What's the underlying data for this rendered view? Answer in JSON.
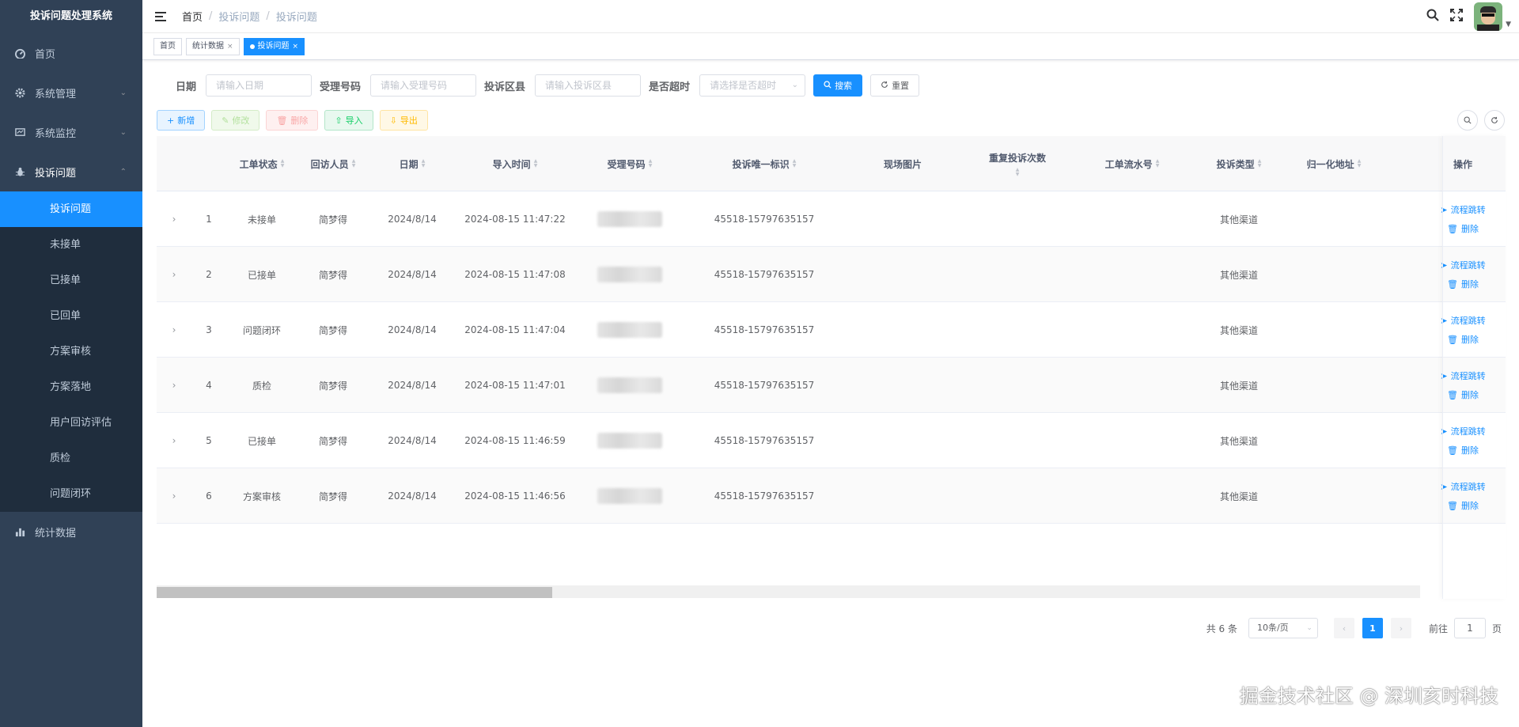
{
  "app_title": "投诉问题处理系统",
  "sidebar": {
    "items": [
      {
        "label": "首页",
        "icon": "dashboard-icon"
      },
      {
        "label": "系统管理",
        "icon": "gear-icon",
        "expandable": true
      },
      {
        "label": "系统监控",
        "icon": "monitor-icon",
        "expandable": true
      },
      {
        "label": "投诉问题",
        "icon": "bug-icon",
        "expanded": true
      },
      {
        "label": "统计数据",
        "icon": "bar-chart-icon"
      }
    ],
    "sub_items": [
      "投诉问题",
      "未接单",
      "已接单",
      "已回单",
      "方案审核",
      "方案落地",
      "用户回访评估",
      "质检",
      "问题闭环"
    ],
    "active_sub": "投诉问题"
  },
  "header": {
    "breadcrumb": [
      "首页",
      "投诉问题",
      "投诉问题"
    ]
  },
  "tags": [
    {
      "label": "首页"
    },
    {
      "label": "统计数据"
    },
    {
      "label": "投诉问题",
      "active": true
    }
  ],
  "filter": {
    "date_label": "日期",
    "date_placeholder": "请输入日期",
    "accept_label": "受理号码",
    "accept_placeholder": "请输入受理号码",
    "district_label": "投诉区县",
    "district_placeholder": "请输入投诉区县",
    "timeout_label": "是否超时",
    "timeout_placeholder": "请选择是否超时",
    "search_label": "搜索",
    "reset_label": "重置"
  },
  "toolbar": {
    "add": "新增",
    "edit": "修改",
    "delete": "删除",
    "import": "导入",
    "export": "导出"
  },
  "table": {
    "headers": {
      "status": "工单状态",
      "visitor": "回访人员",
      "date": "日期",
      "import_time": "导入时间",
      "accept_no": "受理号码",
      "unique_id": "投诉唯一标识",
      "photo": "现场图片",
      "repeat": "重复投诉次数",
      "flow_no": "工单流水号",
      "type": "投诉类型",
      "addr": "归一化地址",
      "ops": "操作"
    },
    "rows": [
      {
        "idx": "1",
        "status": "未接单",
        "visitor": "简梦得",
        "date": "2024/8/14",
        "import_time": "2024-08-15 11:47:22",
        "unique_id": "45518-15797635157",
        "type": "其他渠道"
      },
      {
        "idx": "2",
        "status": "已接单",
        "visitor": "简梦得",
        "date": "2024/8/14",
        "import_time": "2024-08-15 11:47:08",
        "unique_id": "45518-15797635157",
        "type": "其他渠道"
      },
      {
        "idx": "3",
        "status": "问题闭环",
        "visitor": "简梦得",
        "date": "2024/8/14",
        "import_time": "2024-08-15 11:47:04",
        "unique_id": "45518-15797635157",
        "type": "其他渠道"
      },
      {
        "idx": "4",
        "status": "质检",
        "visitor": "简梦得",
        "date": "2024/8/14",
        "import_time": "2024-08-15 11:47:01",
        "unique_id": "45518-15797635157",
        "type": "其他渠道"
      },
      {
        "idx": "5",
        "status": "已接单",
        "visitor": "简梦得",
        "date": "2024/8/14",
        "import_time": "2024-08-15 11:46:59",
        "unique_id": "45518-15797635157",
        "type": "其他渠道"
      },
      {
        "idx": "6",
        "status": "方案审核",
        "visitor": "简梦得",
        "date": "2024/8/14",
        "import_time": "2024-08-15 11:46:56",
        "unique_id": "45518-15797635157",
        "type": "其他渠道"
      }
    ],
    "op_flow": "流程跳转",
    "op_delete": "删除"
  },
  "pager": {
    "total": "共 6 条",
    "page_size": "10条/页",
    "current": "1",
    "goto_label": "前往",
    "goto_value": "1",
    "page_suffix": "页"
  },
  "watermark": "掘金技术社区 @ 深圳亥时科技"
}
